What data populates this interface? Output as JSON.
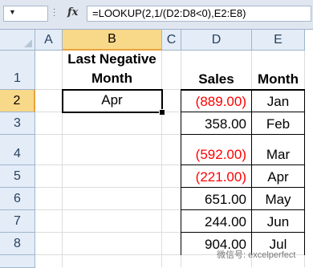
{
  "formula_bar": {
    "fx_label": "fx",
    "formula": "=LOOKUP(2,1/(D2:D8<0),E2:E8)"
  },
  "columns": [
    "A",
    "B",
    "C",
    "D",
    "E"
  ],
  "rows": [
    "1",
    "2",
    "3",
    "4",
    "5",
    "6",
    "7",
    "8"
  ],
  "selected": {
    "column": "B",
    "row": "2"
  },
  "cells": {
    "b1_line1": "Last Negative",
    "b1_line2": "Month",
    "b2": "Apr",
    "d1": "Sales",
    "e1": "Month"
  },
  "data_rows": [
    {
      "sales": "(889.00)",
      "month": "Jan",
      "negative": true
    },
    {
      "sales": "358.00",
      "month": "Feb",
      "negative": false
    },
    {
      "sales": "(592.00)",
      "month": "Mar",
      "negative": true
    },
    {
      "sales": "(221.00)",
      "month": "Apr",
      "negative": true
    },
    {
      "sales": "651.00",
      "month": "May",
      "negative": false
    },
    {
      "sales": "244.00",
      "month": "Jun",
      "negative": false
    },
    {
      "sales": "904.00",
      "month": "Jul",
      "negative": false
    }
  ],
  "colors": {
    "negative": "#ff0000",
    "selection_header": "#f8d889",
    "header": "#e4ecf7"
  },
  "watermark": "微信号: excelperfect"
}
